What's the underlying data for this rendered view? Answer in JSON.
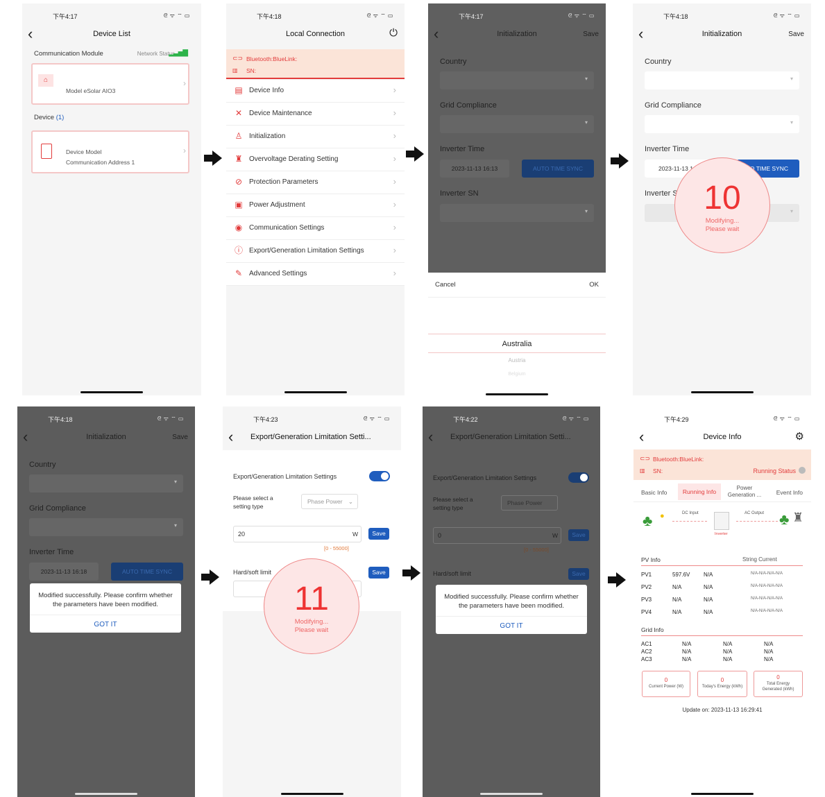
{
  "status_times": {
    "p1": "下午4:17",
    "p2": "下午4:18",
    "p3": "下午4:17",
    "p4": "下午4:18",
    "p5": "下午4:18",
    "p6": "下午4:23",
    "p7": "下午4:22",
    "p8": "下午4:29"
  },
  "status_icons": "ᘓ ᯤ ⌔ ▭",
  "p1": {
    "title": "Device List",
    "comm_module": "Communication Module",
    "network_status": "Network Status",
    "model": "Model eSolar AIO3",
    "device_label": "Device",
    "device_count": "(1)",
    "device_model": "Device Model",
    "comm_address": "Communication Address 1"
  },
  "p2": {
    "title": "Local Connection",
    "bluetooth": "Bluetooth:BlueLink:",
    "sn": "SN:",
    "menu": [
      "Device Info",
      "Device Maintenance",
      "Initialization",
      "Overvoltage Derating Setting",
      "Protection Parameters",
      "Power Adjustment",
      "Communication Settings",
      "Export/Generation Limitation Settings",
      "Advanced Settings"
    ]
  },
  "init": {
    "title": "Initialization",
    "save": "Save",
    "country": "Country",
    "grid": "Grid Compliance",
    "inverter_time": "Inverter Time",
    "time_value": "2023-11-13 16:13",
    "time_value2": "2023-11-13 16:18",
    "time_value_short": "2023-11-13 1",
    "auto_sync": "AUTO TIME SYNC",
    "auto_sync_short": "O TIME SYNC",
    "inverter_sn": "Inverter SN",
    "inverter_sn_short": "Inverter S"
  },
  "picker": {
    "cancel": "Cancel",
    "ok": "OK",
    "selected": "Australia",
    "next": "Austria",
    "next2": "Belgium"
  },
  "p4": {
    "count": "10",
    "modifying": "Modifying...",
    "wait": "Please wait"
  },
  "dialog": {
    "message": "Modified successfully. Please confirm whether the parameters have been modified.",
    "button": "GOT IT"
  },
  "export": {
    "title": "Export/Generation Limitation Setti...",
    "setting": "Export/Generation Limitation Settings",
    "select_type": "Please select a setting type",
    "phase_power": "Phase Power",
    "value": "20",
    "value2": "0",
    "unit": "W",
    "range": "[0 - 55000]",
    "save": "Save",
    "hard_soft": "Hard/soft limit",
    "count": "11"
  },
  "p8": {
    "title": "Device Info",
    "bluetooth": "Bluetooth:BlueLink:",
    "sn": "SN:",
    "running_status": "Running Status",
    "tabs": [
      "Basic Info",
      "Running Info",
      "Power Generation ...",
      "Event Info"
    ],
    "dc_input": "DC Input",
    "ac_output": "AC Output",
    "inverter": "Inverter",
    "pv_info": "PV Info",
    "string_current": "String Current",
    "pv_rows": [
      {
        "name": "PV1",
        "v": "597.6V",
        "a": "N/A",
        "s": "N/A-N/A-N/A-N/A"
      },
      {
        "name": "PV2",
        "v": "N/A",
        "a": "N/A",
        "s": "N/A-N/A-N/A-N/A"
      },
      {
        "name": "PV3",
        "v": "N/A",
        "a": "N/A",
        "s": "N/A-N/A-N/A-N/A"
      },
      {
        "name": "PV4",
        "v": "N/A",
        "a": "N/A",
        "s": "N/A-N/A-N/A-N/A"
      }
    ],
    "grid_info": "Grid Info",
    "ac_rows": [
      {
        "name": "AC1",
        "a": "N/A",
        "b": "N/A",
        "c": "N/A"
      },
      {
        "name": "AC2",
        "a": "N/A",
        "b": "N/A",
        "c": "N/A"
      },
      {
        "name": "AC3",
        "a": "N/A",
        "b": "N/A",
        "c": "N/A"
      }
    ],
    "stats": [
      {
        "value": "0",
        "label": "Current Power (W)"
      },
      {
        "value": "0",
        "label": "Today's Energy (kWh)"
      },
      {
        "value": "0",
        "label": "Total Energy Generated (kWh)"
      }
    ],
    "update_on": "Update on: 2023-11-13 16:29:41"
  },
  "colors": {
    "accent_red": "#e23b3b",
    "primary_blue": "#1f5dbe",
    "overlay": "#5a5a5a"
  }
}
